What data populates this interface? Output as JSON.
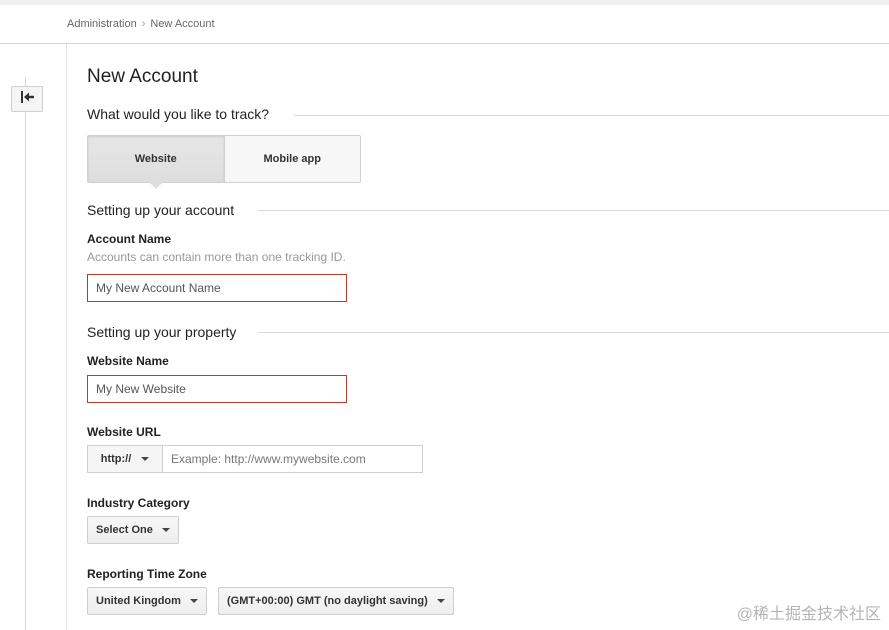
{
  "breadcrumb": {
    "root": "Administration",
    "separator": "›",
    "current": "New Account"
  },
  "page": {
    "title": "New Account"
  },
  "track": {
    "heading": "What would you like to track?",
    "options": [
      {
        "label": "Website",
        "selected": true
      },
      {
        "label": "Mobile app",
        "selected": false
      }
    ]
  },
  "account": {
    "heading": "Setting up your account",
    "name_label": "Account Name",
    "name_hint": "Accounts can contain more than one tracking ID.",
    "name_value": "My New Account Name"
  },
  "property": {
    "heading": "Setting up your property",
    "website_name_label": "Website Name",
    "website_name_value": "My New Website",
    "url_label": "Website URL",
    "protocol_selected": "http://",
    "url_placeholder": "Example: http://www.mywebsite.com",
    "industry_label": "Industry Category",
    "industry_selected": "Select One",
    "timezone_label": "Reporting Time Zone",
    "country_selected": "United Kingdom",
    "timezone_selected": "(GMT+00:00) GMT (no daylight saving)"
  },
  "watermark": "@稀土掘金技术社区",
  "icons": {
    "back": "back-arrow-icon",
    "caret": "caret-down-icon"
  },
  "colors": {
    "invalid_border": "#c0392b"
  }
}
